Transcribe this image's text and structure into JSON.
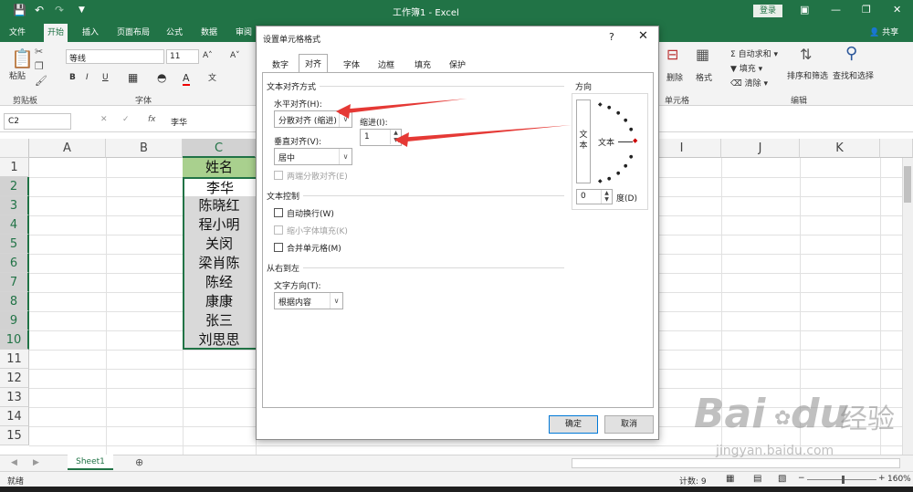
{
  "titlebar": {
    "title": "工作簿1  -  Excel",
    "login": "登录"
  },
  "ribbon_tabs": [
    "文件",
    "开始",
    "插入",
    "页面布局",
    "公式",
    "数据",
    "审阅"
  ],
  "share": "共享",
  "ribbon": {
    "paste": "粘贴",
    "clipboard": "剪贴板",
    "font_name": "等线",
    "font_size": "11",
    "font_group": "字体",
    "delete": "删除",
    "format": "格式",
    "cells_group": "单元格",
    "autosum": "自动求和",
    "fill": "填充",
    "clear": "清除",
    "sort": "排序和筛选",
    "find": "查找和选择",
    "edit_group": "编辑"
  },
  "formula": {
    "namebox": "C2",
    "fx": "fx",
    "value": "李华"
  },
  "columns": [
    "A",
    "B",
    "C",
    "",
    "",
    "",
    "",
    "I",
    "J",
    "K"
  ],
  "rows": [
    "1",
    "2",
    "3",
    "4",
    "5",
    "6",
    "7",
    "8",
    "9",
    "10",
    "11",
    "12",
    "13",
    "14",
    "15"
  ],
  "cells": [
    "姓名",
    "李华",
    "陈晓红",
    "程小明",
    "关闵",
    "梁肖陈",
    "陈经",
    "康康",
    "张三",
    "刘思思"
  ],
  "sheet": {
    "tab": "Sheet1"
  },
  "status": {
    "mode": "就绪",
    "count": "计数: 9",
    "zoom": "160%"
  },
  "dialog": {
    "title": "设置单元格格式",
    "help": "?",
    "tabs": [
      "数字",
      "对齐",
      "字体",
      "边框",
      "填充",
      "保护"
    ],
    "text_align_section": "文本对齐方式",
    "horizontal_label": "水平对齐(H):",
    "horizontal_value": "分散对齐 (缩进)",
    "indent_label": "缩进(I):",
    "indent_value": "1",
    "vertical_label": "垂直对齐(V):",
    "vertical_value": "居中",
    "justify_distributed": "两端分散对齐(E)",
    "text_control_section": "文本控制",
    "wrap": "自动换行(W)",
    "shrink": "缩小字体填充(K)",
    "merge": "合并单元格(M)",
    "rtl_section": "从右到左",
    "text_direction_label": "文字方向(T):",
    "text_direction_value": "根据内容",
    "orientation_section": "方向",
    "orient_vertical_text": "文本",
    "orient_text": "文本",
    "degree_value": "0",
    "degree_label": "度(D)",
    "ok": "确定",
    "cancel": "取消"
  },
  "watermark": {
    "brand": "Bai",
    "brand2": "du",
    "cn": "经验",
    "url": "jingyan.baidu.com"
  }
}
